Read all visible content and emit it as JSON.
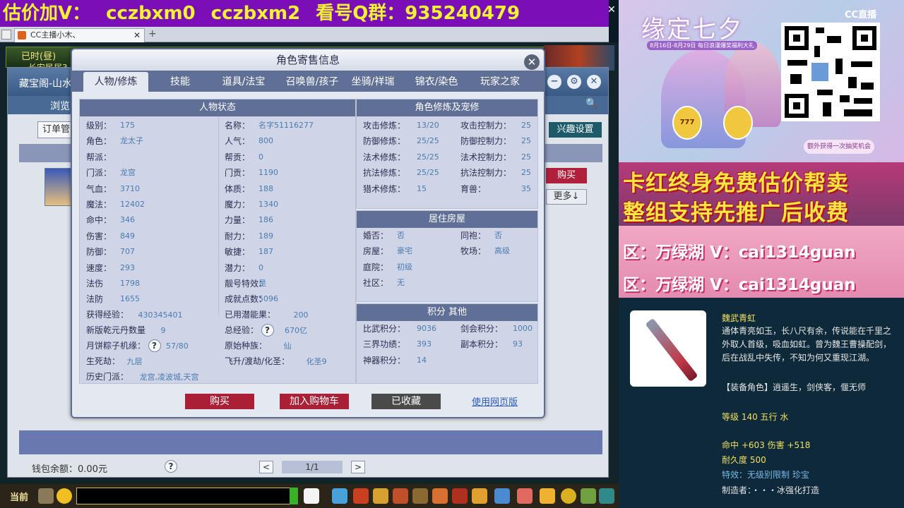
{
  "banner": {
    "parts": [
      "估价加V：",
      "cczbxm0",
      "cczbxm2",
      "看号Q群：935240479"
    ]
  },
  "browser": {
    "tab_label": "CC主播小木、",
    "new_tab": "+"
  },
  "game": {
    "status_day": "已时(昼)",
    "status_sub": "长安民居3"
  },
  "cbg": {
    "title": "藏宝阁-山水",
    "browse": "浏览",
    "order": "订单管",
    "interest": "兴趣设置",
    "buy": "购买",
    "more": "更多↓",
    "wallet": "钱包余额：0.00元",
    "page": "1/1",
    "prev": "<",
    "next": ">",
    "help": "?"
  },
  "modal": {
    "title": "角色寄售信息",
    "close": "✕",
    "tabs": [
      "人物/修炼",
      "技能",
      "道具/法宝",
      "召唤兽/孩子",
      "坐骑/祥瑞",
      "锦衣/染色",
      "玩家之家"
    ],
    "status_head": "人物状态",
    "left_rows": [
      {
        "label": "级别：",
        "value": "175"
      },
      {
        "label": "角色：",
        "value": "龙太子"
      },
      {
        "label": "帮派：",
        "value": ""
      },
      {
        "label": "门派：",
        "value": "龙宫"
      },
      {
        "label": "气血：",
        "value": "3710"
      },
      {
        "label": "魔法：",
        "value": "12402"
      },
      {
        "label": "命中：",
        "value": "346"
      },
      {
        "label": "伤害：",
        "value": "849"
      },
      {
        "label": "防御：",
        "value": "707"
      },
      {
        "label": "速度：",
        "value": "293"
      },
      {
        "label": "法伤",
        "value": "1798"
      },
      {
        "label": "法防",
        "value": "1655"
      }
    ],
    "mid_rows": [
      {
        "label": "名称：",
        "value": "名字51116277"
      },
      {
        "label": "人气：",
        "value": "800"
      },
      {
        "label": "帮贡：",
        "value": "0"
      },
      {
        "label": "门贡：",
        "value": "1190"
      },
      {
        "label": "体质：",
        "value": "188"
      },
      {
        "label": "魔力：",
        "value": "1340"
      },
      {
        "label": "力量：",
        "value": "186"
      },
      {
        "label": "耐力：",
        "value": "189"
      },
      {
        "label": "敏捷：",
        "value": "187"
      },
      {
        "label": "潜力：",
        "value": "0"
      },
      {
        "label": "靓号特效：",
        "value": "是"
      },
      {
        "label": "成就点数：",
        "value": "5096"
      }
    ],
    "extra": {
      "exp_label": "获得经验：",
      "exp_value": "430345401",
      "potential_label": "已用潜能果：",
      "potential_value": "200",
      "pills_label": "新版乾元丹数量",
      "pills_value": "9",
      "total_exp_label": "总经验：",
      "total_exp_value": "670亿",
      "zongzi_label": "月饼粽子机缘：",
      "zongzi_value": "57/80",
      "race_label": "原始种族：",
      "race_value": "仙",
      "life_label": "生死劫：",
      "life_value": "九层",
      "fly_label": "飞升/渡劫/化圣：",
      "fly_value": "化圣9",
      "history_label": "历史门派：",
      "history_value": "龙宫,凌波城,天宫"
    },
    "cultivation_head": "角色修炼及宠修",
    "cultivation": [
      {
        "l1": "攻击修炼：",
        "v1": "13/20",
        "l2": "攻击控制力：",
        "v2": "25"
      },
      {
        "l1": "防御修炼：",
        "v1": "25/25",
        "l2": "防御控制力：",
        "v2": "25"
      },
      {
        "l1": "法术修炼：",
        "v1": "25/25",
        "l2": "法术控制力：",
        "v2": "25"
      },
      {
        "l1": "抗法修炼：",
        "v1": "25/25",
        "l2": "抗法控制力：",
        "v2": "25"
      },
      {
        "l1": "猎术修炼：",
        "v1": "15",
        "l2": "育兽：",
        "v2": "35"
      }
    ],
    "house_head": "居住房屋",
    "house": [
      {
        "l1": "婚否：",
        "v1": "否",
        "l2": "同袍：",
        "v2": "否"
      },
      {
        "l1": "房屋：",
        "v1": "豪宅",
        "l2": "牧场：",
        "v2": "高级"
      },
      {
        "l1": "庭院：",
        "v1": "初级",
        "l2": "",
        "v2": ""
      },
      {
        "l1": "社区：",
        "v1": "无",
        "l2": "",
        "v2": ""
      }
    ],
    "score_head": "积分 其他",
    "score": [
      {
        "l1": "比武积分：",
        "v1": "9036",
        "l2": "剑会积分：",
        "v2": "1000"
      },
      {
        "l1": "三界功绩：",
        "v1": "393",
        "l2": "副本积分：",
        "v2": "93"
      },
      {
        "l1": "神器积分：",
        "v1": "14",
        "l2": "",
        "v2": ""
      }
    ],
    "buy_btn": "购买",
    "cart_btn": "加入购物车",
    "fav_btn": "已收藏",
    "web_link": "使用网页版"
  },
  "taskbar": {
    "current": "当前"
  },
  "stream": {
    "promo_title": "缘定七夕",
    "promo_sub": "8月16日-8月29日 每日浪漫爆奖福利大礼",
    "promo_badge1": "777",
    "promo_badge2": "",
    "promo_tag": "额外获得一次抽奖机会",
    "cc_logo": "CC直播",
    "ad_line1": "卡红终身免费估价帮卖",
    "ad_line2": "整组支持先推广后收费",
    "area1": "区：万绿湖 V：cai1314guan",
    "area2": "区：万绿湖 V：cai1314guan",
    "item_name": "魏武青虹",
    "item_desc": "通体青亮如玉，长八尺有余，传说能在千里之外取人首级，吸血如虹。曾为魏王曹操配剑，后在战乱中失传，不知为何又重现江湖。",
    "item_role": "【装备角色】逍遥生，剑侠客，偃无师",
    "item_lvl": "等级 140 五行 水",
    "item_stats": "命中 +603 伤害 +518",
    "item_dur": "耐久度 500",
    "item_special": "特效：无级别限制 珍宝",
    "item_maker": "制造者：・・・冰强化打造"
  }
}
